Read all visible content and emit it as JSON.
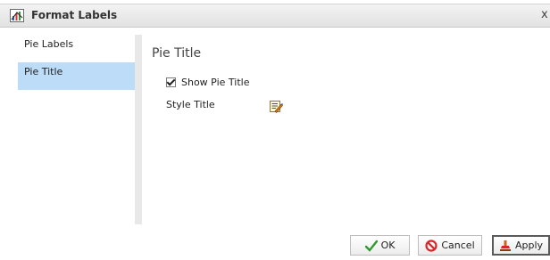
{
  "window": {
    "title": "Format Labels",
    "close_label": "x"
  },
  "sidebar": {
    "items": [
      {
        "label": "Pie Labels",
        "active": false
      },
      {
        "label": "Pie Title",
        "active": true
      }
    ]
  },
  "panel": {
    "title": "Pie Title",
    "show_title": {
      "label": "Show Pie Title",
      "checked": true
    },
    "style_title": {
      "label": "Style Title",
      "icon": "style-edit-icon"
    }
  },
  "buttons": {
    "ok": {
      "label": "OK",
      "icon": "checkmark-icon"
    },
    "cancel": {
      "label": "Cancel",
      "icon": "cancel-icon"
    },
    "apply": {
      "label": "Apply",
      "icon": "apply-icon"
    }
  },
  "colors": {
    "accent": "#bcdcf8",
    "ok_green": "#2e9a2e",
    "cancel_red": "#d9262a"
  }
}
